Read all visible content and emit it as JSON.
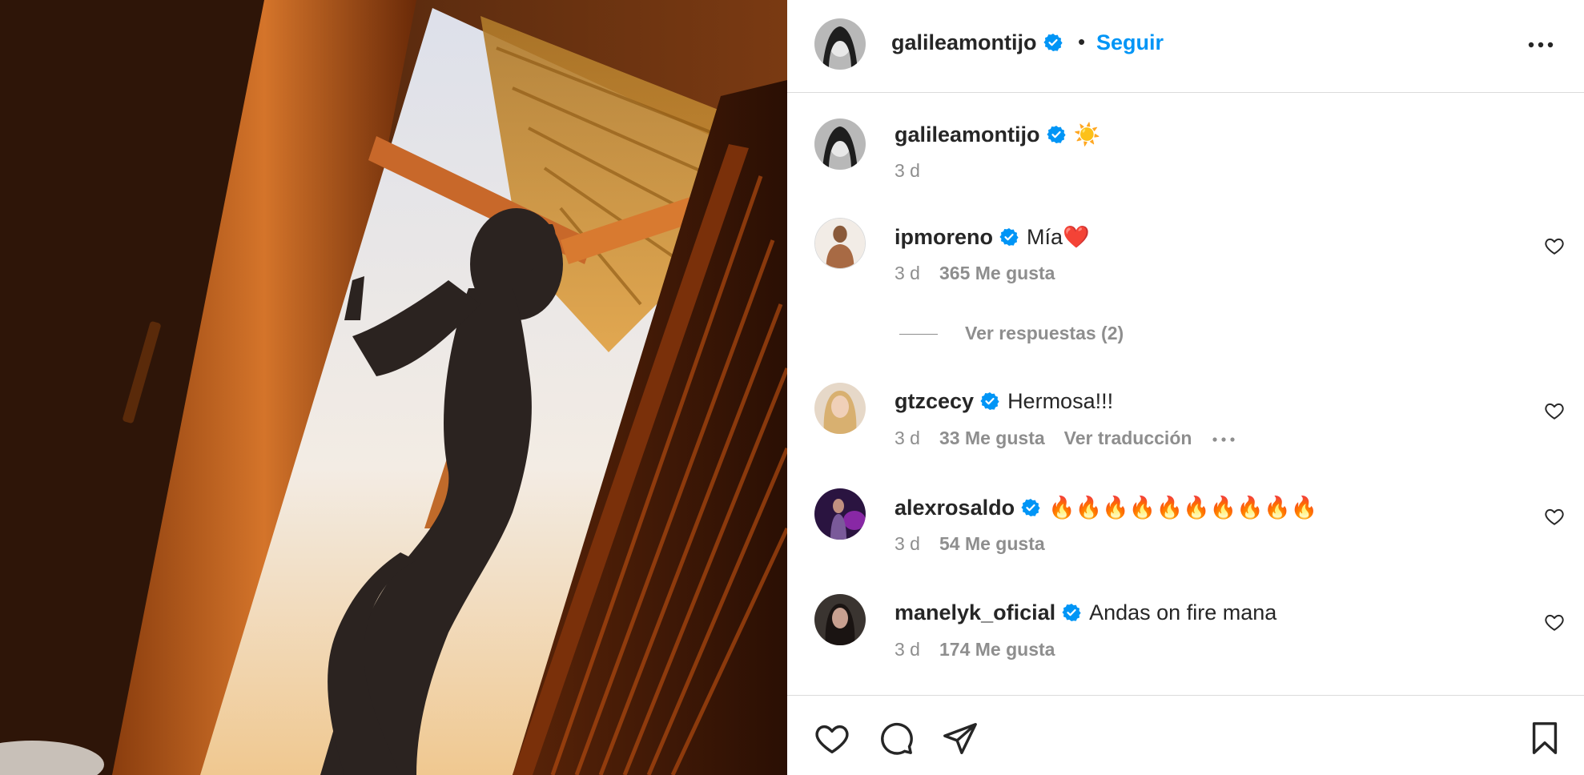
{
  "post": {
    "author": "galileamontijo",
    "follow_label": "Seguir",
    "separator": "•",
    "caption": "☀️",
    "caption_time": "3 d"
  },
  "comments": [
    {
      "user": "ipmoreno",
      "text": "Mía❤️",
      "time": "3 d",
      "likes": "365 Me gusta"
    },
    {
      "user": "gtzcecy",
      "text": "Hermosa!!!",
      "time": "3 d",
      "likes": "33 Me gusta",
      "translate": "Ver traducción"
    },
    {
      "user": "alexrosaldo",
      "text": "🔥🔥🔥🔥🔥🔥🔥🔥🔥🔥",
      "time": "3 d",
      "likes": "54 Me gusta"
    },
    {
      "user": "manelyk_oficial",
      "text": "Andas on fire mana",
      "time": "3 d",
      "likes": "174 Me gusta"
    }
  ],
  "replies_label": "Ver respuestas (2)",
  "icons": {
    "verified": "verified-badge-icon",
    "more": "more-options-icon",
    "like": "heart-icon",
    "comment": "comment-icon",
    "share": "share-icon",
    "save": "bookmark-icon"
  },
  "colors": {
    "accent": "#0095f6",
    "verified": "#0095f6",
    "muted": "#8e8e8e",
    "text": "#262626",
    "divider": "#dbdbdb"
  }
}
